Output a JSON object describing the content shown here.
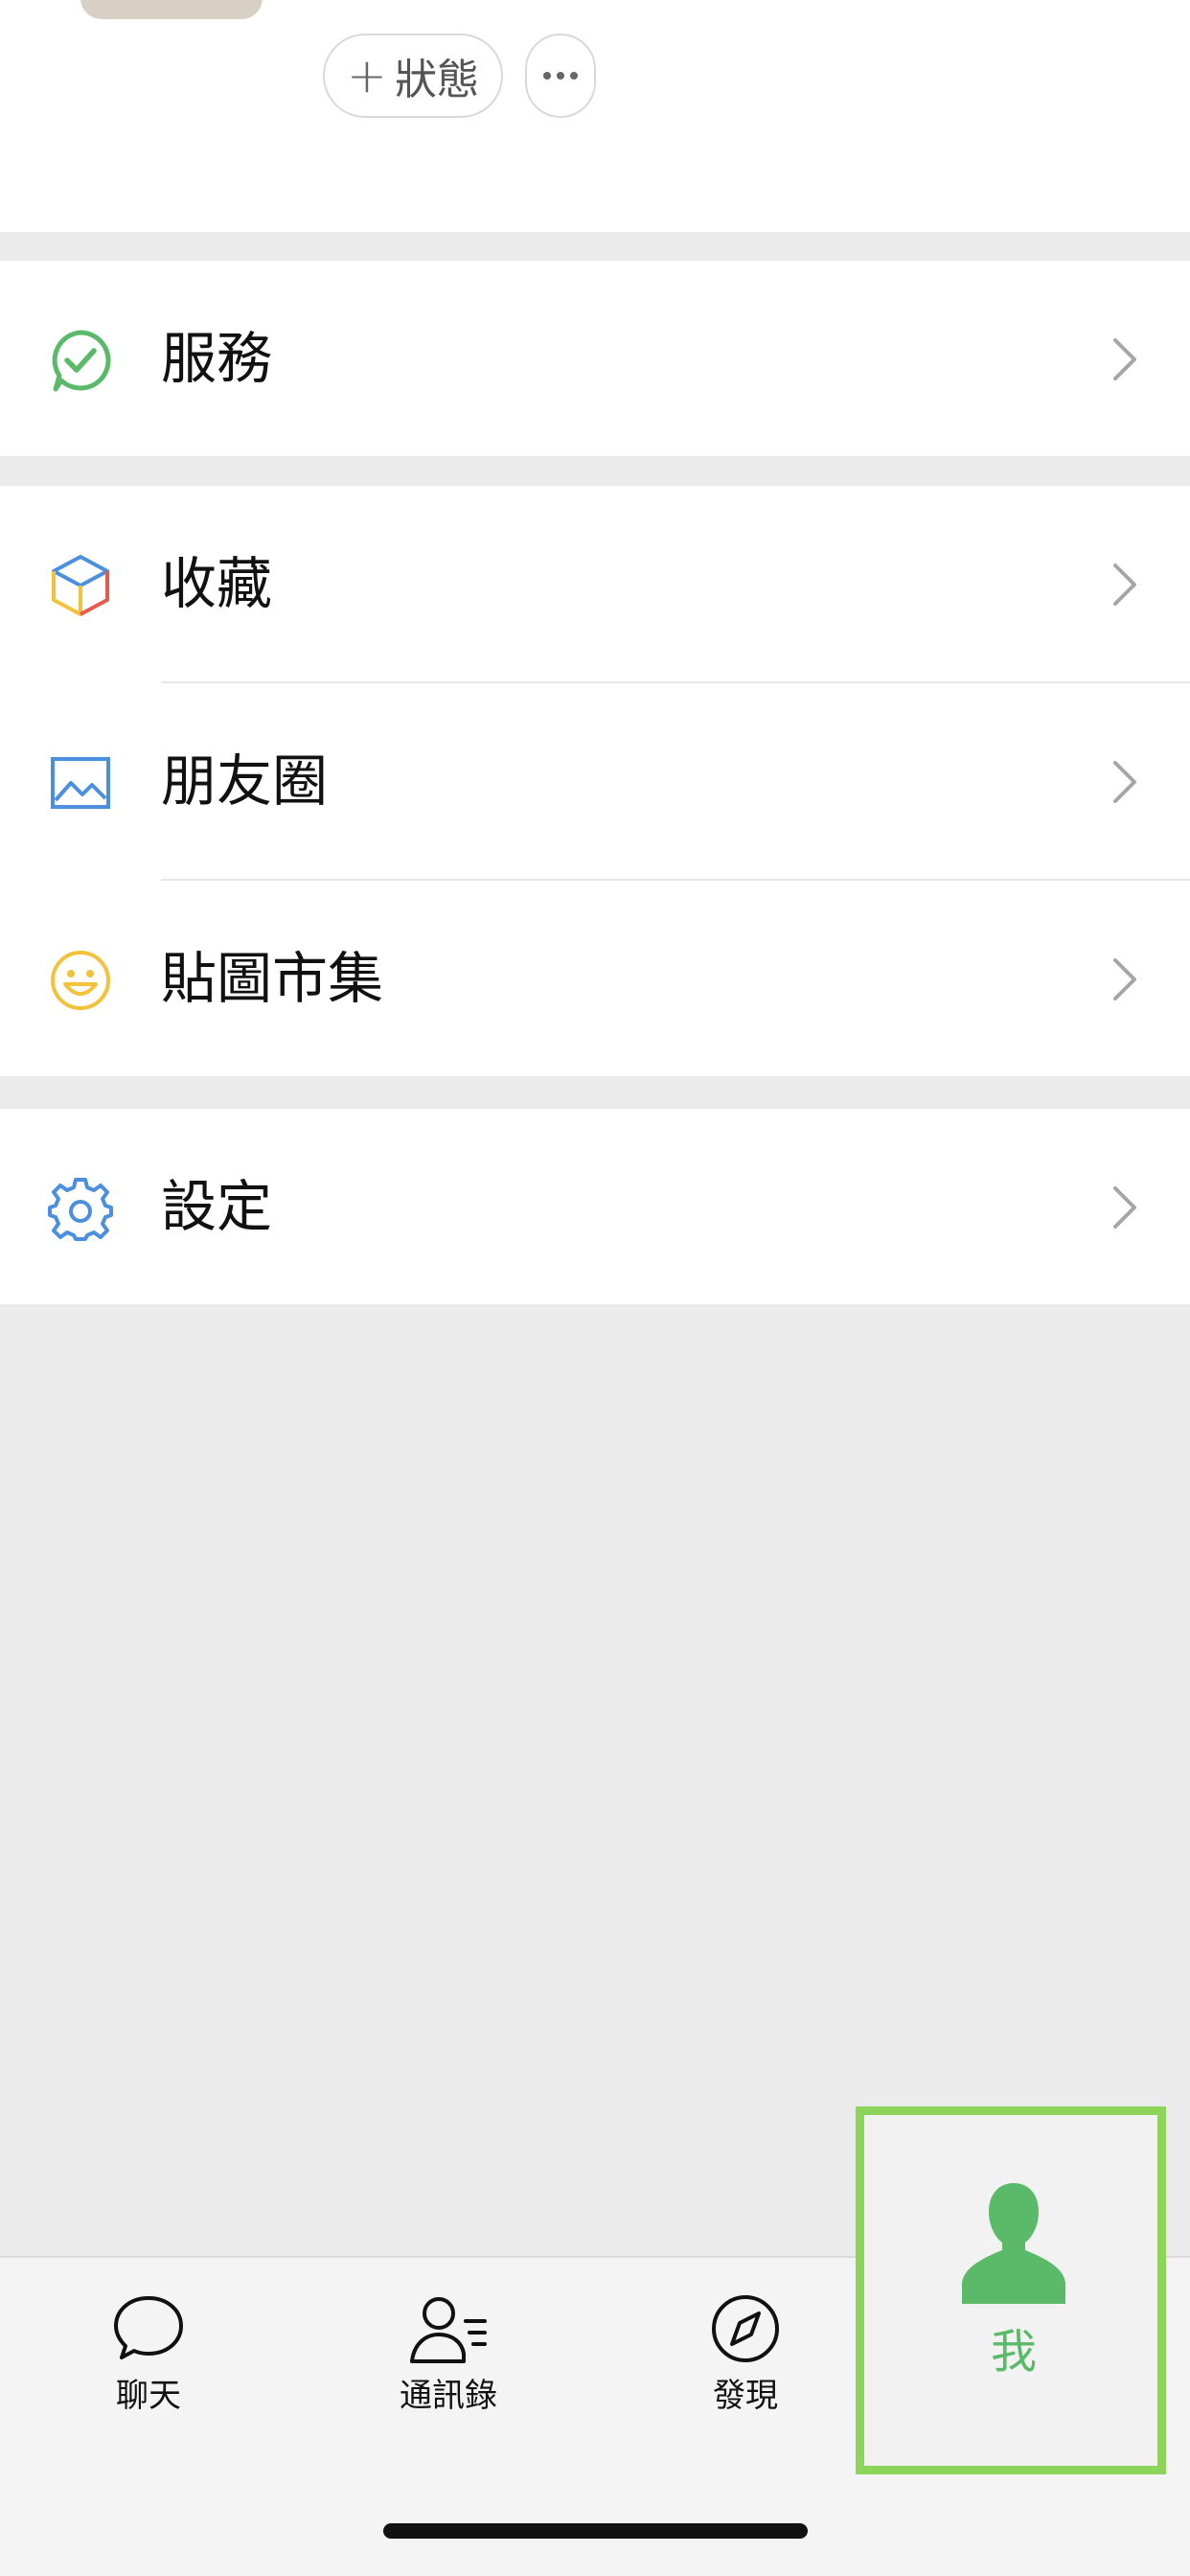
{
  "profile": {
    "status_button_label": "狀態",
    "status_button_plus": "+",
    "more_button_icon": "ellipsis-icon"
  },
  "menu": {
    "services": {
      "label": "服務",
      "icon": "wechat-pay-check-icon"
    },
    "favorites": {
      "label": "收藏",
      "icon": "cube-icon"
    },
    "moments": {
      "label": "朋友圈",
      "icon": "image-icon"
    },
    "stickers": {
      "label": "貼圖市集",
      "icon": "smiley-icon"
    },
    "settings": {
      "label": "設定",
      "icon": "gear-icon"
    }
  },
  "tabbar": {
    "chats": {
      "label": "聊天",
      "icon": "chat-bubble-icon"
    },
    "contacts": {
      "label": "通訊錄",
      "icon": "contacts-icon"
    },
    "discover": {
      "label": "發現",
      "icon": "compass-icon"
    },
    "me": {
      "label": "我",
      "icon": "person-icon",
      "active": true
    }
  },
  "colors": {
    "accent_green": "#5aba6a",
    "highlight_border": "#8cd45a",
    "background": "#ebebeb"
  }
}
